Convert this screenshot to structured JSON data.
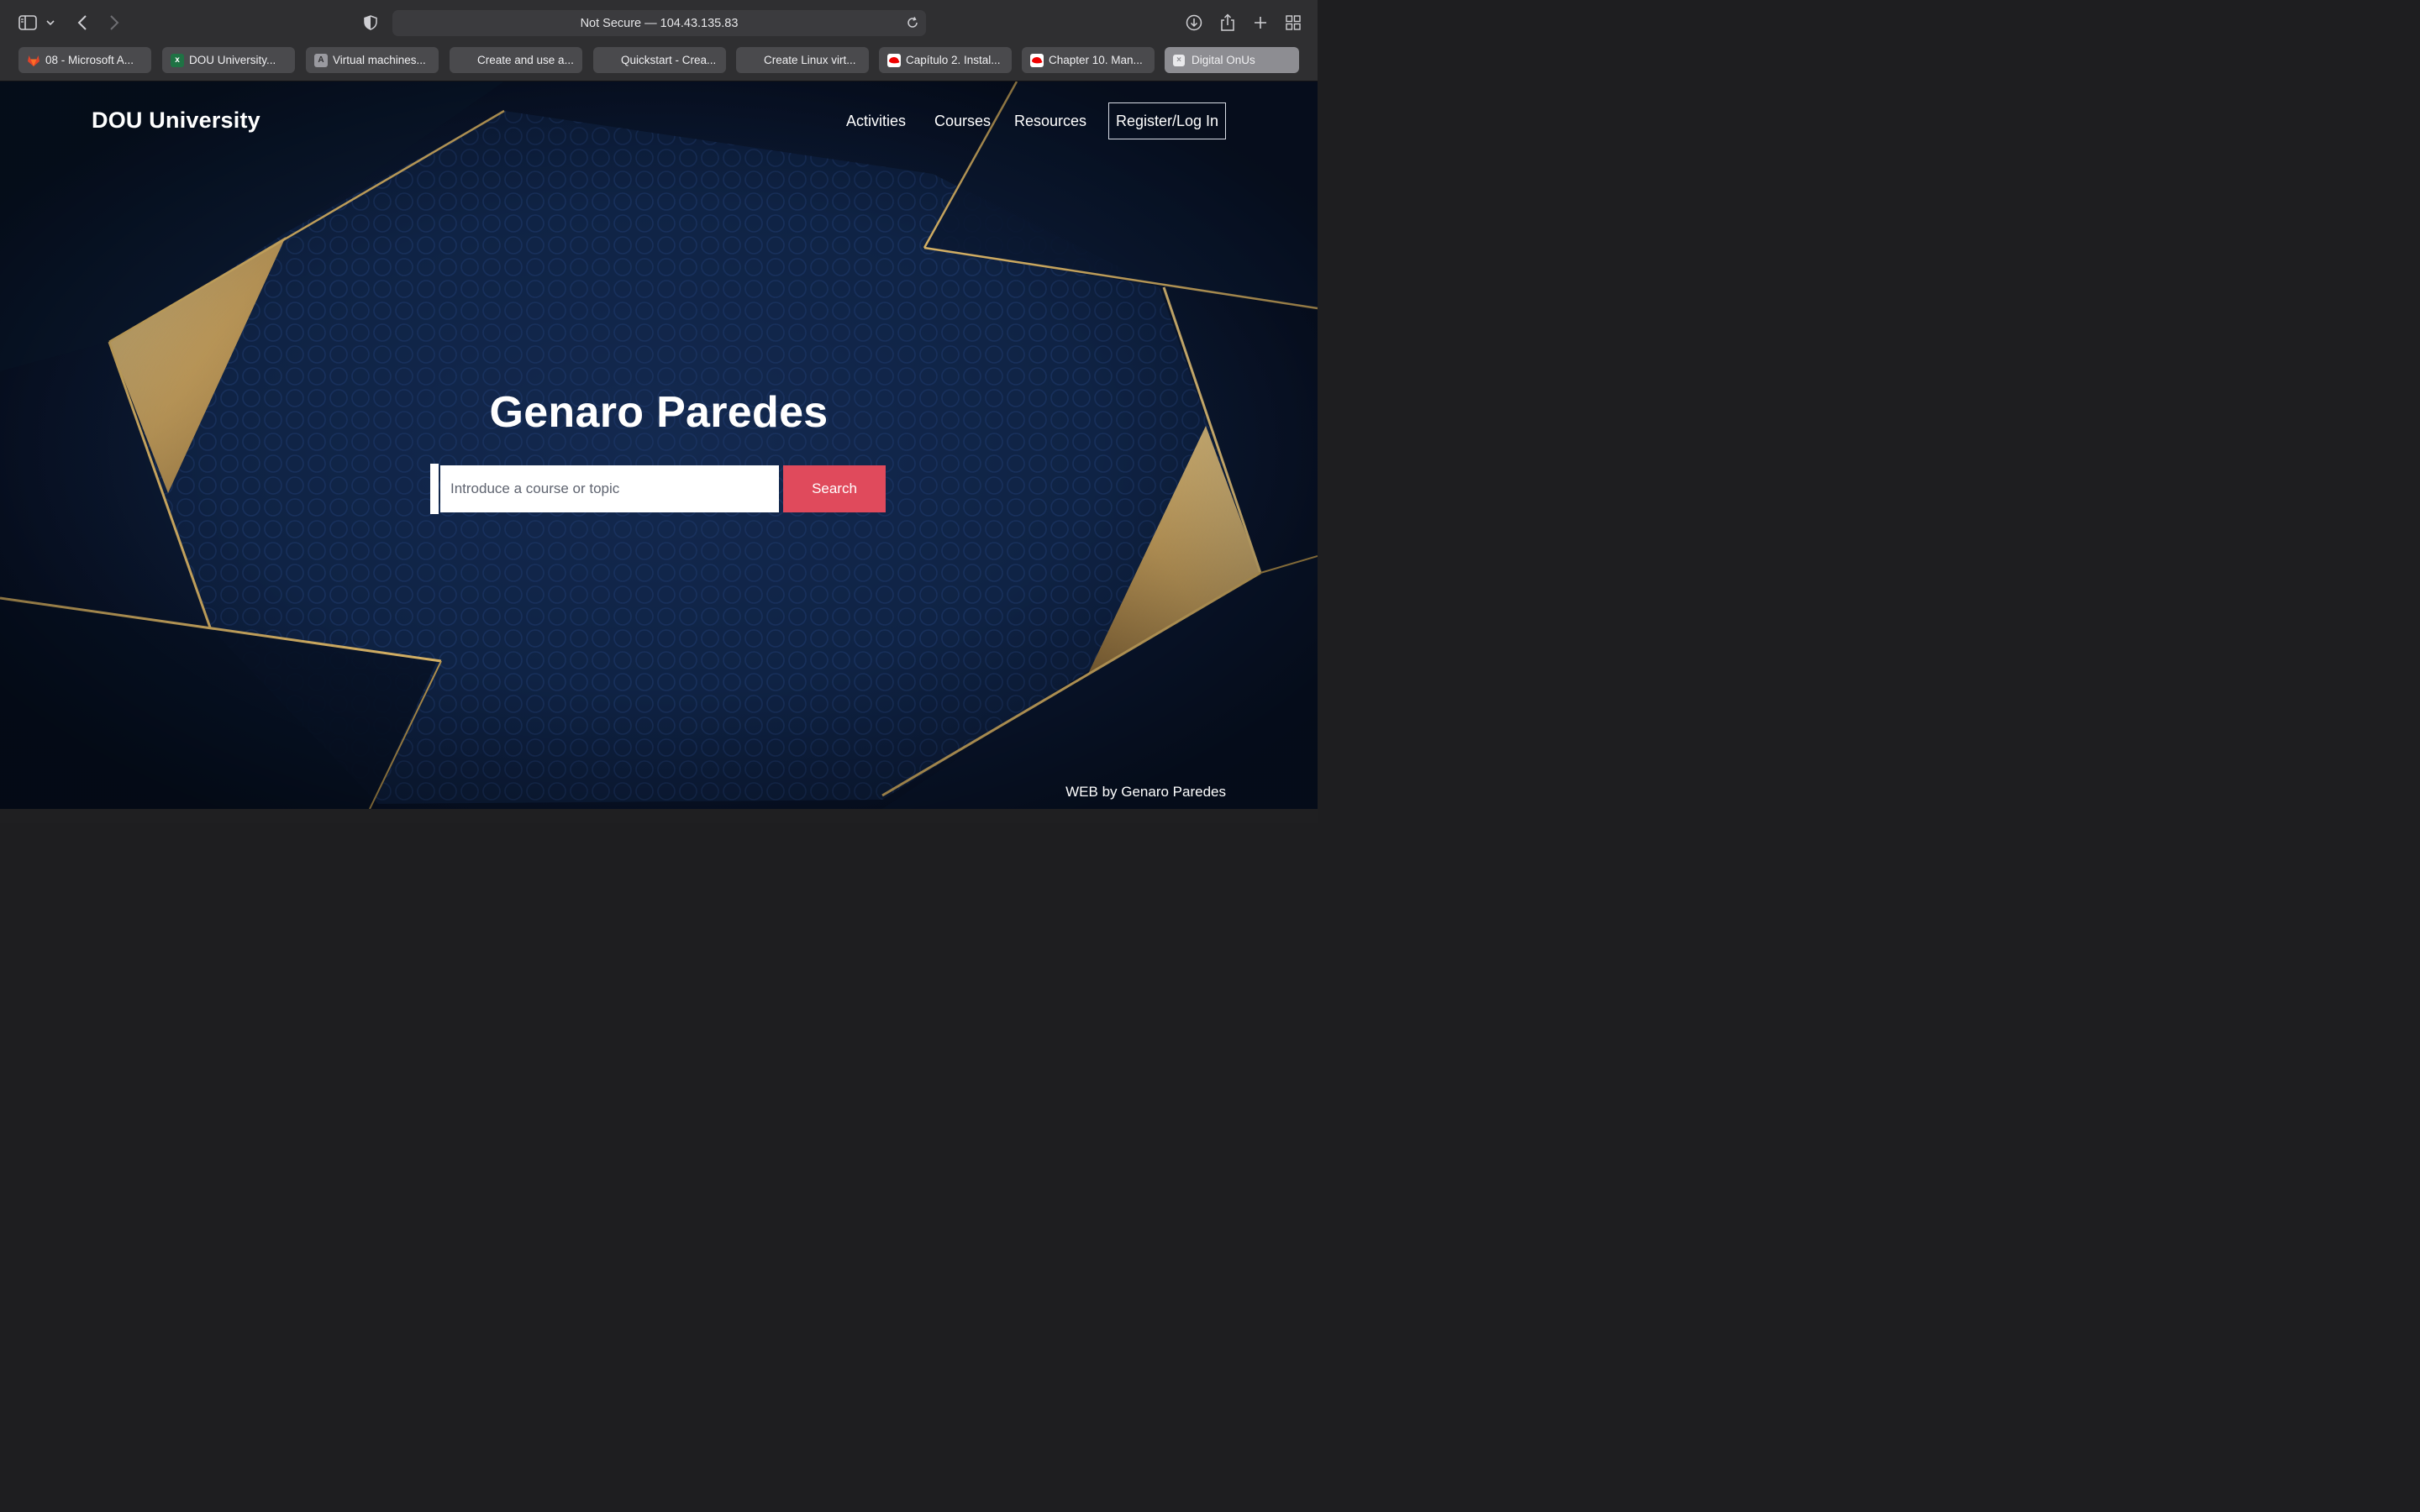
{
  "browser": {
    "address": "Not Secure — 104.43.135.83",
    "tabs": [
      {
        "label": "08 - Microsoft A...",
        "favicon": "gitlab-icon",
        "active": false
      },
      {
        "label": "DOU University...",
        "favicon": "excel-icon",
        "active": false
      },
      {
        "label": "Virtual machines...",
        "favicon": "a-letter-icon",
        "active": false
      },
      {
        "label": "Create and use a...",
        "favicon": "microsoft-icon",
        "active": false
      },
      {
        "label": "Quickstart - Crea...",
        "favicon": "microsoft-icon",
        "active": false
      },
      {
        "label": "Create Linux virt...",
        "favicon": "microsoft-icon",
        "active": false
      },
      {
        "label": "Capítulo 2. Instal...",
        "favicon": "redhat-icon",
        "active": false
      },
      {
        "label": "Chapter 10. Man...",
        "favicon": "redhat-icon",
        "active": false
      },
      {
        "label": "Digital OnUs",
        "favicon": "x-box-icon",
        "active": true
      }
    ],
    "favicon_letters": {
      "excel": "x",
      "a": "A",
      "x": "×"
    }
  },
  "site": {
    "brand": "DOU University",
    "nav": {
      "activities": "Activities",
      "courses": "Courses",
      "resources": "Resources",
      "register": "Register/Log In"
    },
    "hero_title": "Genaro Paredes",
    "search": {
      "placeholder": "Introduce a course or topic",
      "button": "Search"
    },
    "footer_credit": "WEB by Genaro Paredes"
  },
  "colors": {
    "accent_button": "#e04a5c",
    "gold": "#c9a55c",
    "navy": "#0d1c36"
  }
}
